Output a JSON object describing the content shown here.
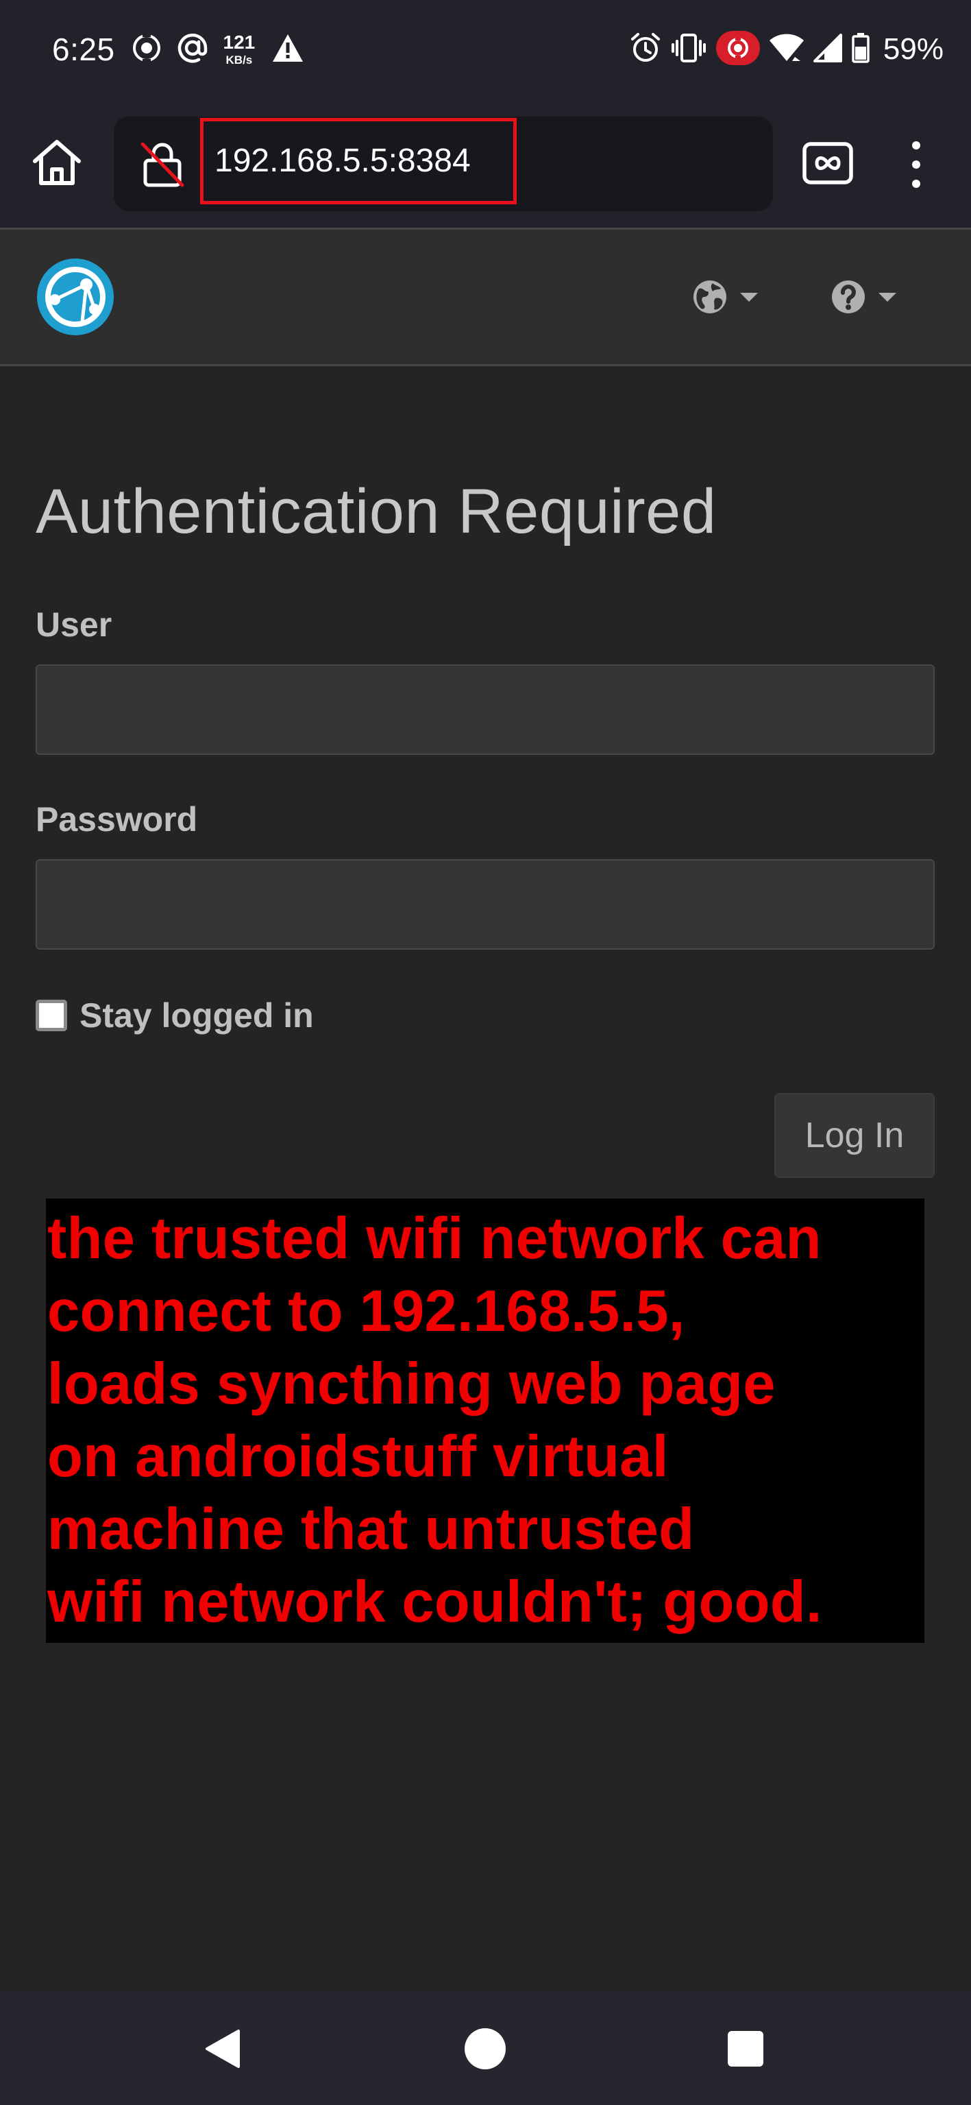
{
  "status_bar": {
    "time": "6:25",
    "net_speed_value": "121",
    "net_speed_unit": "KB/s",
    "battery_percent": "59%",
    "icons_left": [
      "screen-record-icon",
      "at-sign-icon",
      "net-speed-indicator",
      "warning-icon"
    ],
    "icons_right": [
      "alarm-icon",
      "vibrate-icon",
      "cast-record-icon",
      "wifi-icon",
      "cellular-signal-icon",
      "battery-icon"
    ],
    "record_badge_color": "#d81e2a"
  },
  "browser": {
    "url": "192.168.5.5:8384",
    "url_highlight_color": "#e8121c",
    "icons": [
      "home-icon",
      "not-secure-lock-icon",
      "tabs-icon",
      "more-vert-icon"
    ]
  },
  "navbar": {
    "logo": "syncthing-logo",
    "menus": [
      "language-globe-icon",
      "help-icon"
    ],
    "accent_color": "#1f9fd0"
  },
  "login": {
    "title": "Authentication Required",
    "user_label": "User",
    "user_value": "",
    "password_label": "Password",
    "password_value": "",
    "stay_logged_in_label": "Stay logged in",
    "stay_logged_in_checked": false,
    "login_button": "Log In"
  },
  "annotation": {
    "color": "#f00000",
    "lines": [
      "the trusted wifi network can",
      "connect to 192.168.5.5,",
      "loads syncthing web page",
      "on androidstuff virtual",
      "machine that untrusted",
      "wifi network couldn't; good."
    ]
  },
  "system_nav": {
    "buttons": [
      "back-button",
      "home-button",
      "recents-button"
    ]
  }
}
